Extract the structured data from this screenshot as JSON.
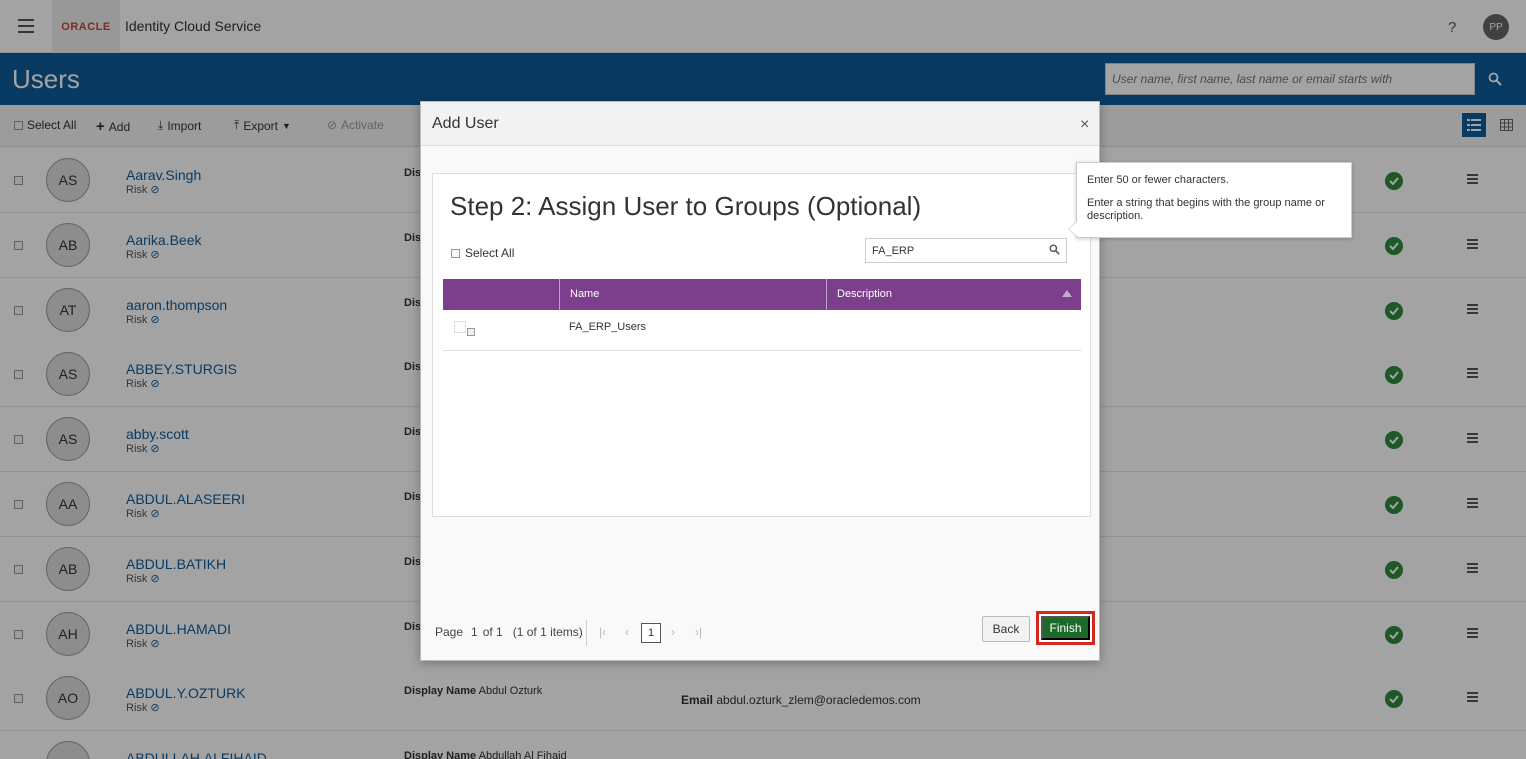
{
  "header": {
    "logo_text": "ORACLE",
    "app_title": "Identity Cloud Service",
    "help": "?",
    "user_initials": "PP"
  },
  "page": {
    "title": "Users",
    "search_placeholder": "User name, first name, last name or email starts with"
  },
  "toolbar": {
    "select_all": "Select All",
    "add": "Add",
    "import": "Import",
    "export": "Export",
    "activate": "Activate"
  },
  "users": [
    {
      "initials": "AS",
      "name": "Aarav.Singh",
      "risk": "Risk",
      "display_label": "Dis",
      "display_name": "",
      "email_label": "",
      "email": ""
    },
    {
      "initials": "AB",
      "name": "Aarika.Beek",
      "risk": "Risk",
      "display_label": "Dis",
      "display_name": "",
      "email_label": "",
      "email": ""
    },
    {
      "initials": "AT",
      "name": "aaron.thompson",
      "risk": "Risk",
      "display_label": "Dis",
      "display_name": "",
      "email_label": "",
      "email": ""
    },
    {
      "initials": "AS",
      "name": "ABBEY.STURGIS",
      "risk": "Risk",
      "display_label": "Dis",
      "display_name": "",
      "email_label": "",
      "email": ""
    },
    {
      "initials": "AS",
      "name": "abby.scott",
      "risk": "Risk",
      "display_label": "Dis",
      "display_name": "",
      "email_label": "",
      "email": ""
    },
    {
      "initials": "AA",
      "name": "ABDUL.ALASEERI",
      "risk": "Risk",
      "display_label": "Dis",
      "display_name": "",
      "email_label": "",
      "email": ""
    },
    {
      "initials": "AB",
      "name": "ABDUL.BATIKH",
      "risk": "Risk",
      "display_label": "Dis",
      "display_name": "",
      "email_label": "",
      "email": ""
    },
    {
      "initials": "AH",
      "name": "ABDUL.HAMADI",
      "risk": "Risk",
      "display_label": "Dis",
      "display_name": "",
      "email_label": "",
      "email": ""
    },
    {
      "initials": "AO",
      "name": "ABDUL.Y.OZTURK",
      "risk": "Risk",
      "display_label": "Display Name",
      "display_name": "Abdul Ozturk",
      "email_label": "Email",
      "email": "abdul.ozturk_zlem@oracledemos.com"
    },
    {
      "initials": "",
      "name": "ABDULLAH.ALFIHAID",
      "risk": "",
      "display_label": "Display Name",
      "display_name": "Abdullah Al Fihaid",
      "email_label": "",
      "email": ""
    }
  ],
  "modal": {
    "title": "Add User",
    "close": "×",
    "step_title": "Step 2: Assign User to Groups (Optional)",
    "select_all": "Select All",
    "group_search_value": "FA_ERP",
    "columns": [
      "Name",
      "Description"
    ],
    "groups": [
      {
        "name": "FA_ERP_Users",
        "description": ""
      }
    ],
    "pager": {
      "page_label": "Page",
      "page": "1",
      "of": "of 1",
      "items": "(1 of 1 items)",
      "current": "1"
    },
    "back": "Back",
    "finish": "Finish"
  },
  "tooltip": {
    "line1": "Enter 50 or fewer characters.",
    "line2": "Enter a string that begins with the group name or description."
  },
  "colors": {
    "brand_blue": "#0f5c9a",
    "table_header": "#7b3f8c",
    "finish_green": "#1d6b2a",
    "highlight_red": "#d7261e",
    "status_green": "#2f8a3c"
  }
}
